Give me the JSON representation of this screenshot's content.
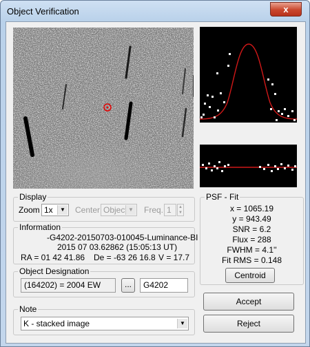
{
  "window": {
    "title": "Object Verification",
    "close_glyph": "x"
  },
  "display": {
    "legend": "Display",
    "zoom_label": "Zoom",
    "zoom_value": "1x",
    "center_label": "Center",
    "center_value": "Object",
    "freq_label": "Freq.",
    "freq_value": "1"
  },
  "information": {
    "legend": "Information",
    "filename": "-G4202-20150703-010045-Luminance-BI",
    "date": "2015 07 03.62862 (15:05:13 UT)",
    "ra": "RA = 01 42 41.86",
    "de": "De = -63 26 16.8",
    "v": "V = 17.7"
  },
  "designation": {
    "legend": "Object Designation",
    "value": "(164202) = 2004 EW",
    "code": "G4202",
    "browse_label": "..."
  },
  "note": {
    "legend": "Note",
    "value": "K - stacked image"
  },
  "psf": {
    "legend": "PSF - Fit",
    "x": "x = 1065.19",
    "y": "y = 943.49",
    "snr": "SNR = 6.2",
    "flux": "Flux = 288",
    "fwhm": "FWHM = 4.1''",
    "fit_rms": "Fit RMS = 0.148",
    "centroid_label": "Centroid"
  },
  "buttons": {
    "accept": "Accept",
    "reject": "Reject"
  },
  "colors": {
    "fit_curve": "#d01818",
    "marker": "#e00000",
    "points": "#ffffff"
  }
}
